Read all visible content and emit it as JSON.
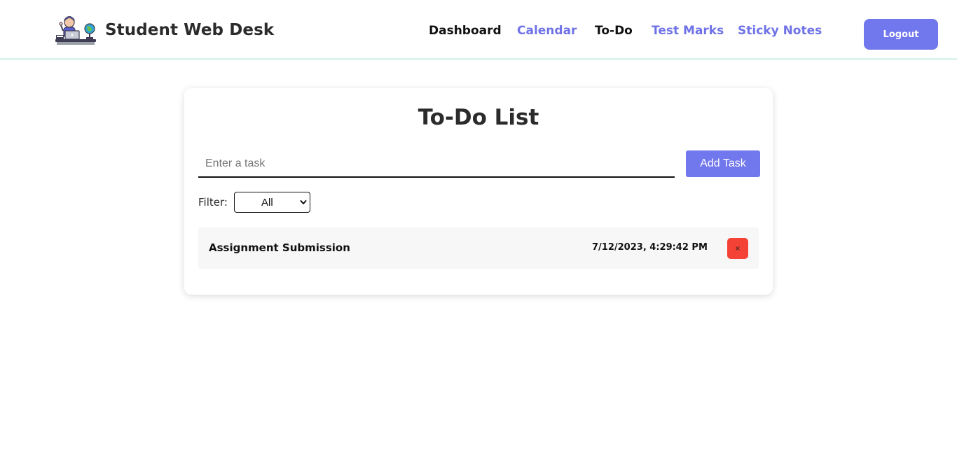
{
  "app": {
    "title": "Student Web Desk"
  },
  "nav": {
    "items": [
      {
        "label": "Dashboard"
      },
      {
        "label": "Calendar"
      },
      {
        "label": "To-Do"
      },
      {
        "label": "Test Marks"
      },
      {
        "label": "Sticky Notes"
      }
    ],
    "logout_label": "Logout"
  },
  "todo": {
    "title": "To-Do List",
    "input": {
      "placeholder": "Enter a task",
      "value": ""
    },
    "add_label": "Add Task",
    "filter": {
      "label": "Filter:",
      "selected": "All"
    },
    "tasks": [
      {
        "name": "Assignment Submission",
        "timestamp": "7/12/2023, 4:29:42 PM",
        "delete_label": "×"
      }
    ]
  },
  "colors": {
    "accent": "#7177ec",
    "nav_link": "#6f73e6",
    "danger": "#f44336",
    "header_border": "#dcf5ee"
  },
  "icons": {
    "logo": "student-at-desk-logo",
    "select": "chevron-down-icon",
    "delete": "close-icon"
  }
}
